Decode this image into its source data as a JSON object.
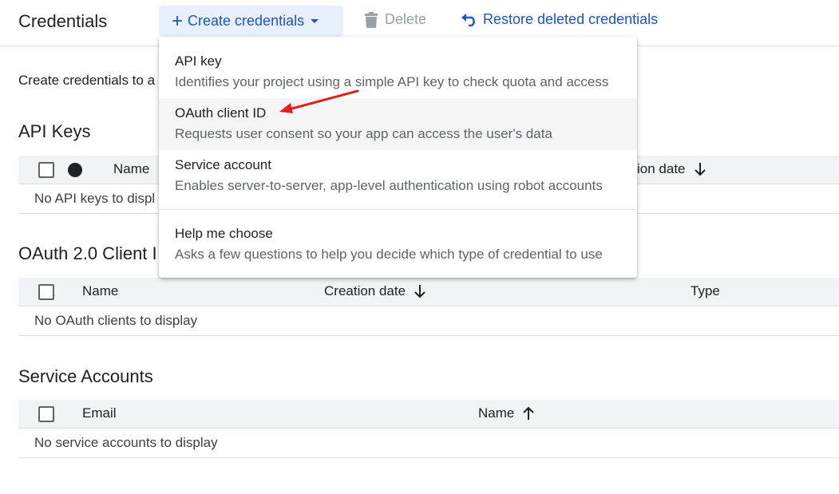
{
  "header": {
    "title": "Credentials",
    "create_label": "Create credentials",
    "delete_label": "Delete",
    "restore_label": "Restore deleted credentials"
  },
  "intro_text": "Create credentials to a",
  "api_keys": {
    "title": "API Keys",
    "columns": [
      "Name",
      "ion date"
    ],
    "empty": "No API keys to displ"
  },
  "oauth": {
    "title": "OAuth 2.0 Client I",
    "columns": [
      "Name",
      "Creation date",
      "Type"
    ],
    "empty": "No OAuth clients to display"
  },
  "service_accounts": {
    "title": "Service Accounts",
    "columns": [
      "Email",
      "Name"
    ],
    "empty": "No service accounts to display"
  },
  "menu": {
    "items": [
      {
        "title": "API key",
        "desc": "Identifies your project using a simple API key to check quota and access"
      },
      {
        "title": "OAuth client ID",
        "desc": "Requests user consent so your app can access the user's data"
      },
      {
        "title": "Service account",
        "desc": "Enables server-to-server, app-level authentication using robot accounts"
      },
      {
        "title": "Help me choose",
        "desc": "Asks a few questions to help you decide which type of credential to use"
      }
    ]
  },
  "colors": {
    "accent": "#1a56c4",
    "annotation_arrow": "#e02020"
  }
}
